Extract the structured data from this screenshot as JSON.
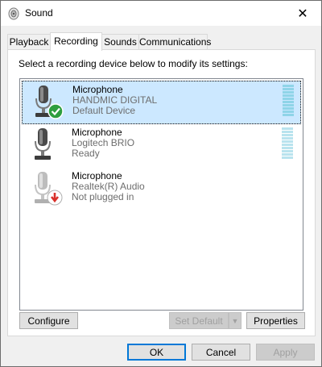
{
  "window": {
    "title": "Sound",
    "close_glyph": "✕"
  },
  "tabs": [
    {
      "label": "Playback",
      "active": false
    },
    {
      "label": "Recording",
      "active": true
    },
    {
      "label": "Sounds",
      "active": false
    },
    {
      "label": "Communications",
      "active": false
    }
  ],
  "panel": {
    "instruction": "Select a recording device below to modify its settings:"
  },
  "devices": [
    {
      "name": "Microphone",
      "driver": "HANDMIC DIGITAL",
      "status": "Default Device",
      "icon": "microphone-default-check-icon",
      "selected": true,
      "badge_color": "#2e9e3e"
    },
    {
      "name": "Microphone",
      "driver": "Logitech BRIO",
      "status": "Ready",
      "icon": "microphone-icon",
      "selected": false
    },
    {
      "name": "Microphone",
      "driver": "Realtek(R) Audio",
      "status": "Not plugged in",
      "icon": "microphone-unplugged-icon",
      "selected": false,
      "badge_color": "#d9312b"
    }
  ],
  "buttons": {
    "configure": "Configure",
    "set_default": "Set Default",
    "properties": "Properties",
    "ok": "OK",
    "cancel": "Cancel",
    "apply": "Apply"
  },
  "colors": {
    "selection": "#cce8ff",
    "level_meter": "#8fd4e8",
    "focus_border": "#0078d7"
  }
}
